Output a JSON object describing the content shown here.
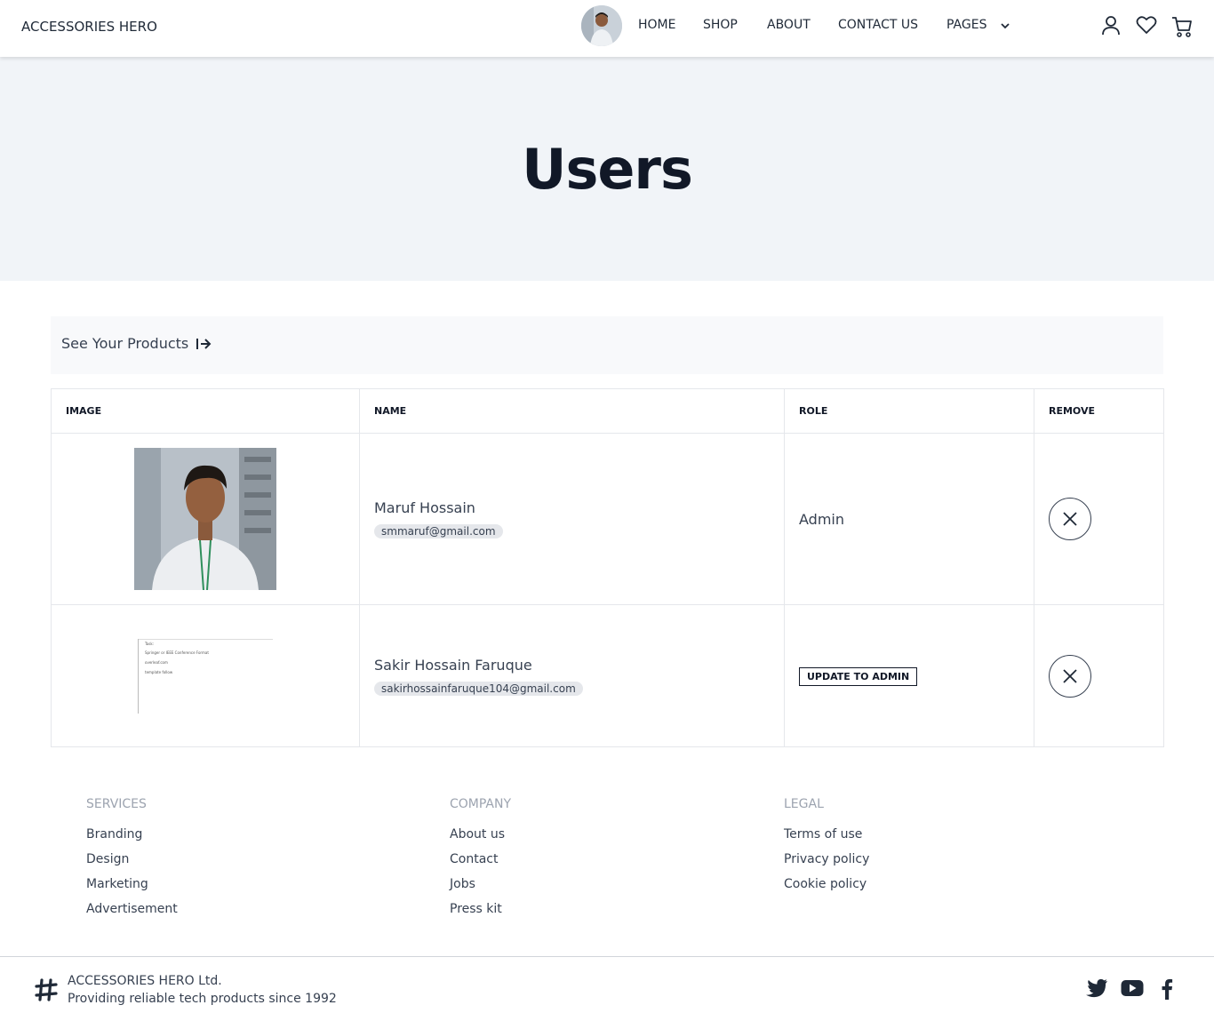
{
  "nav": {
    "brand": "ACCESSORIES HERO",
    "menu": [
      "HOME",
      "SHOP",
      "ABOUT",
      "CONTACT US",
      "PAGES"
    ]
  },
  "hero": {
    "title": "Users"
  },
  "link_bar": {
    "label": "See Your Products"
  },
  "table": {
    "headers": [
      "IMAGE",
      "NAME",
      "ROLE",
      "REMOVE"
    ],
    "rows": [
      {
        "name": "Maruf Hossain",
        "email": "smmaruf@gmail.com",
        "role": "Admin"
      },
      {
        "name": "Sakir Hossain Faruque",
        "email": "sakirhossainfaruque104@gmail.com",
        "role_button": "UPDATE TO ADMIN",
        "thumb_lines": [
          "Task:",
          "Springer or IEEE Conference Format",
          "overleaf.com",
          "template follow"
        ]
      }
    ]
  },
  "footer": {
    "services": {
      "title": "SERVICES",
      "links": [
        "Branding",
        "Design",
        "Marketing",
        "Advertisement"
      ]
    },
    "company": {
      "title": "COMPANY",
      "links": [
        "About us",
        "Contact",
        "Jobs",
        "Press kit"
      ]
    },
    "legal": {
      "title": "LEGAL",
      "links": [
        "Terms of use",
        "Privacy policy",
        "Cookie policy"
      ]
    },
    "company_name": "ACCESSORIES HERO Ltd.",
    "tagline": "Providing reliable tech products since 1992"
  },
  "icons": [
    "user-icon",
    "heart-icon",
    "cart-icon",
    "arrow-right-icon",
    "close-icon",
    "logo-icon",
    "twitter-icon",
    "youtube-icon",
    "facebook-icon"
  ],
  "colors": {
    "hero_bg": "#f1f4f8",
    "text_dark": "#111827",
    "muted": "#9ca3af"
  }
}
